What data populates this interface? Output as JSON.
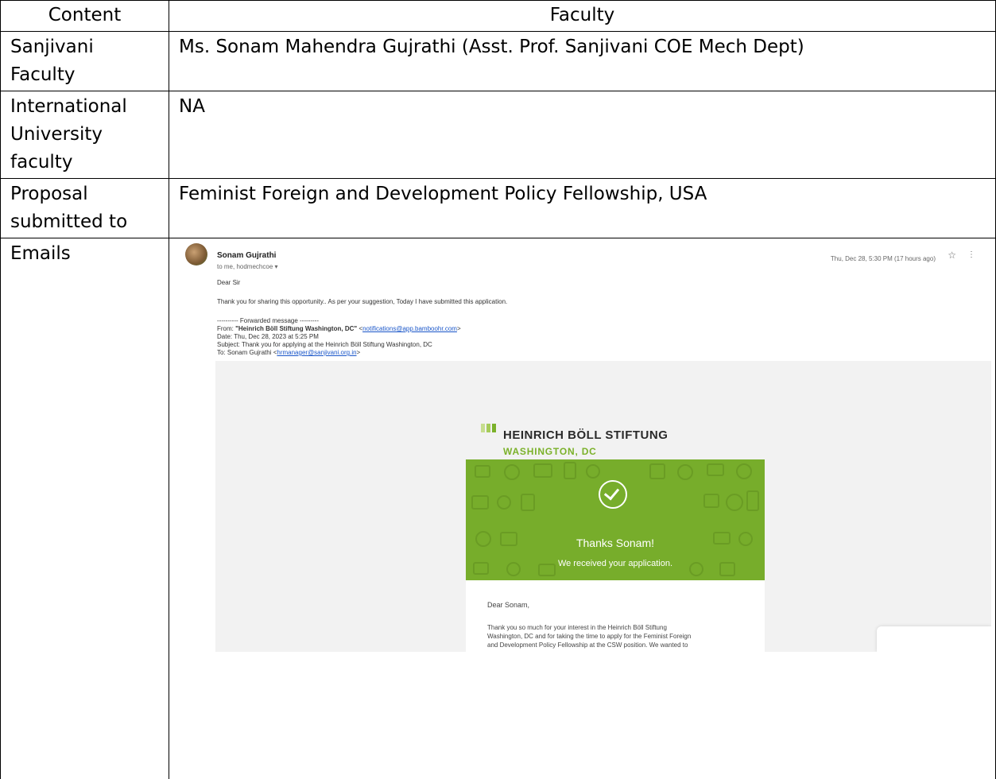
{
  "table": {
    "header": {
      "col1": "Content",
      "col2": "Faculty"
    },
    "rows": [
      {
        "label": "Sanjivani Faculty",
        "value": "Ms. Sonam Mahendra Gujrathi (Asst. Prof. Sanjivani COE Mech Dept)"
      },
      {
        "label": "International University faculty",
        "value": "NA"
      },
      {
        "label": "Proposal submitted to",
        "value": "Feminist Foreign and Development Policy Fellowship, USA"
      },
      {
        "label": "Emails",
        "value": ""
      }
    ]
  },
  "email": {
    "sender_name": "Sonam Gujrathi",
    "to_line": "to me, hodmechcoe",
    "timestamp": "Thu, Dec 28, 5:30 PM (17 hours ago)",
    "greeting": "Dear Sir",
    "message": "Thank you for sharing this opportunity.. As per your suggestion, Today I have submitted this application.",
    "forward_header": "---------- Forwarded message ---------",
    "from_label": "From: ",
    "from_name": "\"Heinrich Böll Stiftung Washington, DC\"",
    "from_email": "notifications@app.bamboohr.com",
    "date_line": "Date: Thu, Dec 28, 2023 at 5:25 PM",
    "subject_line": "Subject: Thank you for applying at the Heinrich Böll Stiftung Washington, DC",
    "to_label": "To: Sonam Gujrathi ",
    "to_email": "hrmanager@sanjivani.org.in",
    "logo_name": "HEINRICH BÖLL STIFTUNG",
    "logo_city": "WASHINGTON, DC",
    "banner_title": "Thanks Sonam!",
    "banner_subtitle": "We received your application.",
    "body_greeting": "Dear Sonam,",
    "body_lines": [
      "Thank you so much for your interest in the Heinrich Böll Stiftung",
      "Washington, DC and for taking the time to apply for the Feminist Foreign",
      "and Development Policy Fellowship at the CSW position. We wanted to"
    ],
    "colors": {
      "banner_green": "#77ad2b",
      "logo_green": "#7bb12a",
      "link_blue": "#1a56c9"
    }
  }
}
